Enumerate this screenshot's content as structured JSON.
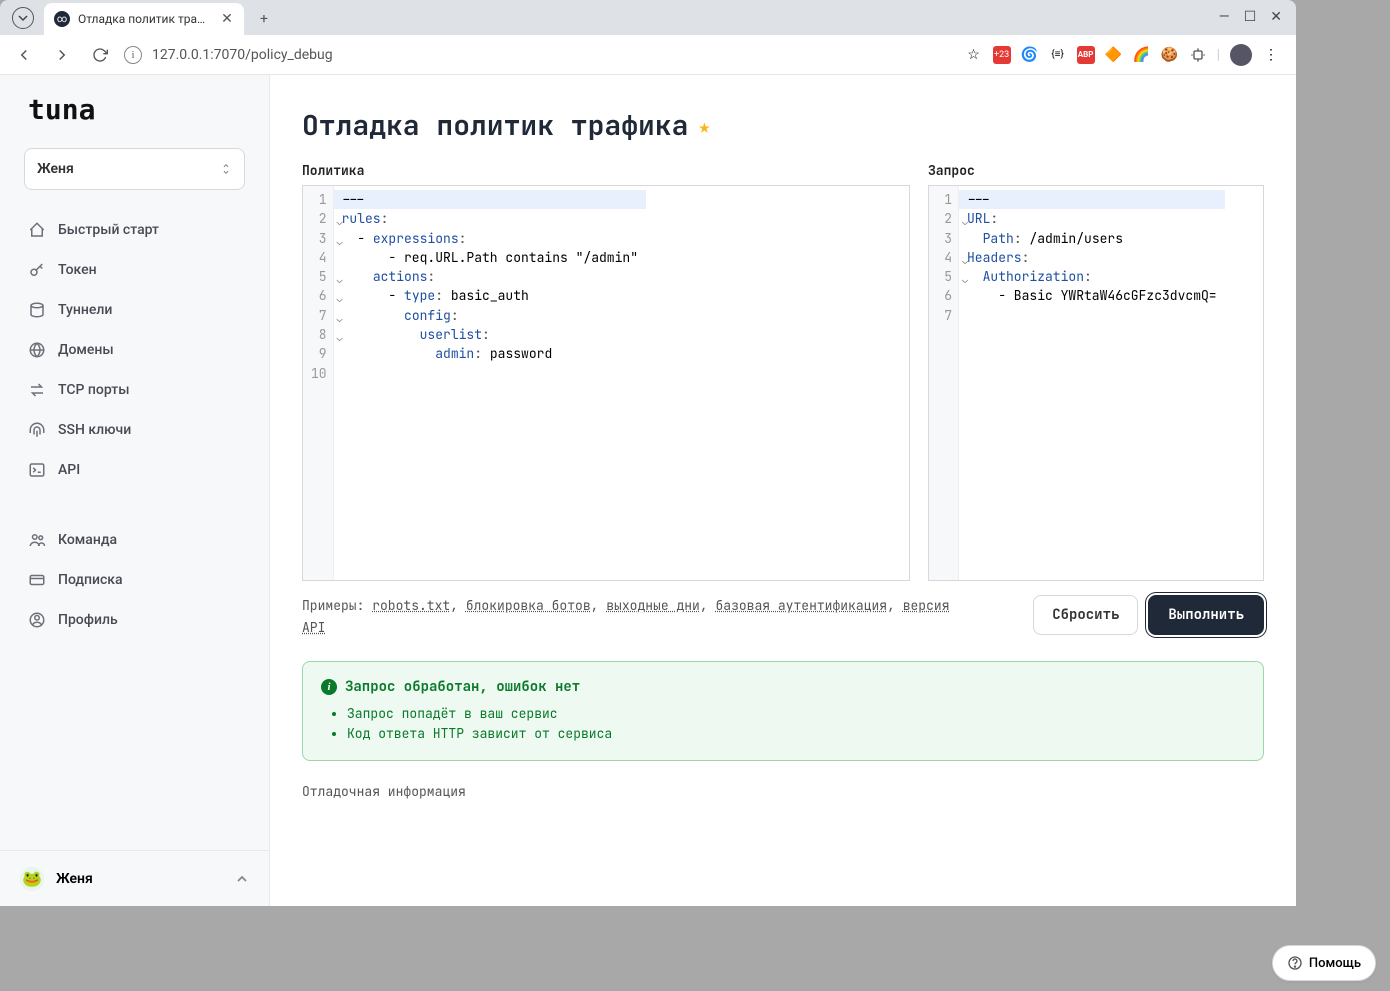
{
  "browser": {
    "tab_title": "Отладка политик трафика",
    "url": "127.0.0.1:7070/policy_debug"
  },
  "logo": "tuna",
  "team_selector": "Женя",
  "nav": {
    "quickstart": "Быстрый старт",
    "token": "Токен",
    "tunnels": "Туннели",
    "domains": "Домены",
    "tcpports": "TCP порты",
    "sshkeys": "SSH ключи",
    "api": "API",
    "team": "Команда",
    "billing": "Подписка",
    "profile": "Профиль"
  },
  "footer_user": "Женя",
  "page_title": "Отладка политик трафика",
  "policy": {
    "label": "Политика",
    "lines": {
      "l1": "---",
      "l2_key": "rules",
      "l3_key": "expressions",
      "l4": "      - req.URL.Path contains \"/admin\"",
      "l5_key": "actions",
      "l6_key": "type",
      "l6_val": " basic_auth",
      "l7_key": "config",
      "l8_key": "userlist",
      "l9_key": "admin",
      "l9_val": " password"
    }
  },
  "request": {
    "label": "Запрос",
    "lines": {
      "l1": "---",
      "l2_key": "URL",
      "l3_key": "Path",
      "l3_val": " /admin/users",
      "l4_key": "Headers",
      "l5_key": "Authorization",
      "l6": "    - Basic YWRtaW46cGFzc3dvcmQ="
    }
  },
  "examples": {
    "prefix": "Примеры: ",
    "robots": "robots.txt",
    "bots": "блокировка ботов",
    "weekend": "выходные дни",
    "basicauth": "базовая аутентификация",
    "apiver": "версия API"
  },
  "buttons": {
    "reset": "Сбросить",
    "execute": "Выполнить"
  },
  "result": {
    "heading": "Запрос обработан, ошибок нет",
    "item1": "Запрос попадёт в ваш сервис",
    "item2": "Код ответа HTTP зависит от сервиса"
  },
  "debug_label": "Отладочная информация",
  "help": "Помощь"
}
